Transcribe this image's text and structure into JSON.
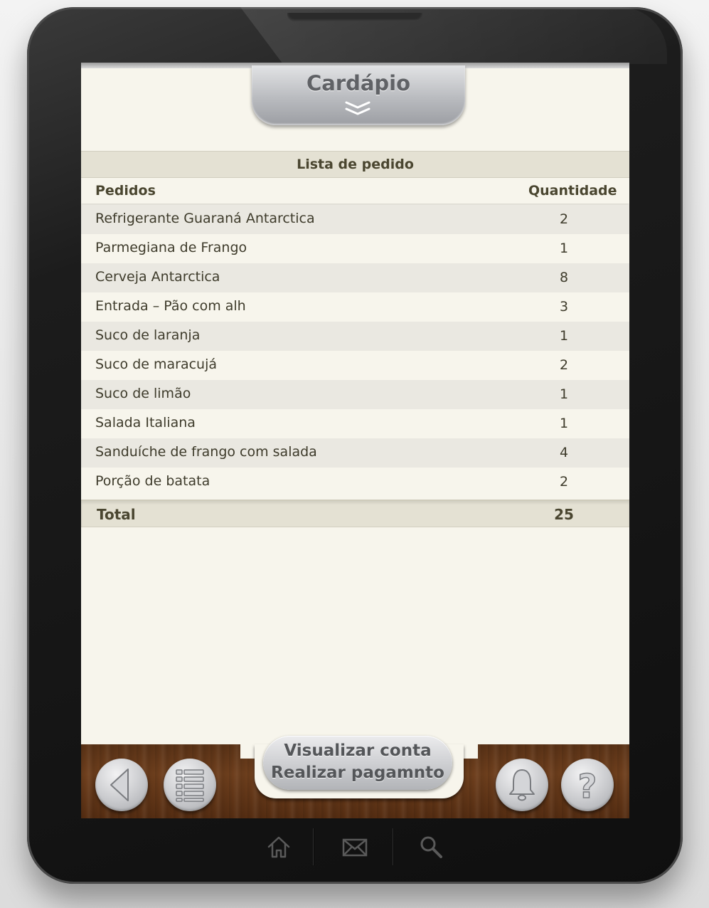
{
  "header": {
    "title": "Cardápio"
  },
  "order_list": {
    "section_title": "Lista de pedido",
    "columns": {
      "name": "Pedidos",
      "quantity": "Quantidade"
    },
    "rows": [
      {
        "name": "Refrigerante Guaraná Antarctica",
        "qty": "2"
      },
      {
        "name": "Parmegiana de Frango",
        "qty": "1"
      },
      {
        "name": "Cerveja Antarctica",
        "qty": "8"
      },
      {
        "name": "Entrada – Pão com alh",
        "qty": "3"
      },
      {
        "name": "Suco de laranja",
        "qty": "1"
      },
      {
        "name": "Suco de maracujá",
        "qty": "2"
      },
      {
        "name": "Suco de limão",
        "qty": "1"
      },
      {
        "name": "Salada Italiana",
        "qty": "1"
      },
      {
        "name": "Sanduíche de frango com salada",
        "qty": "4"
      },
      {
        "name": "Porção de batata",
        "qty": "2"
      }
    ],
    "total_label": "Total",
    "total_value": "25"
  },
  "bottom_bar": {
    "action_line1": "Visualizar conta",
    "action_line2": "Realizar pagamnto",
    "icons": [
      "back-arrow-icon",
      "list-icon",
      "bell-icon",
      "help-icon"
    ]
  },
  "system_bar": {
    "icons": [
      "home-icon",
      "mail-icon",
      "search-icon"
    ]
  },
  "colors": {
    "screen_bg": "#f7f5ec",
    "row_alt_bg": "#eae8e1",
    "text": "#3e3b2b",
    "wood": "#6e3f1d"
  }
}
